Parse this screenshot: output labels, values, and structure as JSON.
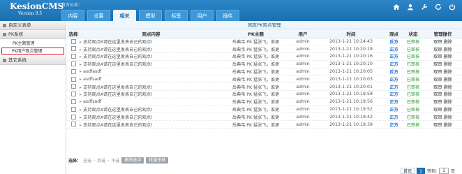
{
  "header": {
    "logo_name": "KesionCMS",
    "logo_version": "Version 9.5",
    "notice": "官方公告：",
    "tabs": [
      "内容",
      "设置",
      "相关",
      "模型",
      "标签",
      "用户",
      "插件"
    ],
    "active_tab": 2
  },
  "sidebar": {
    "groups": [
      {
        "label": "自定义表单",
        "items": []
      },
      {
        "label": "PK系统",
        "items": [
          "PK主题管理",
          "PK用户观点管理"
        ]
      },
      {
        "label": "其它系统",
        "items": []
      }
    ],
    "active_item": "PK用户观点管理"
  },
  "page_title": "网友PK观点管理",
  "table": {
    "headers": [
      "选择",
      "观点内容",
      "PK主题",
      "用户",
      "时间",
      "观点",
      "状态",
      "管理操作"
    ],
    "rows": [
      {
        "content": "支持观点B请在这里发表自己的观点!",
        "topic": "岳典韦 PK 猛张飞，谁更",
        "user": "admin",
        "time": "2013-1-21 10:24:43",
        "side": "反方",
        "status": "已审核",
        "op1": "取审",
        "op2": "删除"
      },
      {
        "content": "支持观点A请在这里发表自己的观点!",
        "topic": "岳典韦 PK 猛张飞，谁更",
        "user": "admin",
        "time": "2013-1-21 10:20:19",
        "side": "正方",
        "status": "已审核",
        "op1": "取审",
        "op2": "删除"
      },
      {
        "content": "支持观点A请在这里发表自己的观点!",
        "topic": "岳典韦 PK 猛张飞，谁更",
        "user": "admin",
        "time": "2013-1-21 10:20:16",
        "side": "正方",
        "status": "已审核",
        "op1": "取审",
        "op2": "删除"
      },
      {
        "content": "支持观点A请在这里发表自己的观点!",
        "topic": "岳典韦 PK 猛张飞，谁更",
        "user": "admin",
        "time": "2013-1-21 10:20:10",
        "side": "正方",
        "status": "已审核",
        "op1": "取审",
        "op2": "删除"
      },
      {
        "content": "asdfasdf",
        "topic": "岳典韦 PK 猛张飞，谁更",
        "user": "admin",
        "time": "2013-1-21 10:20:05",
        "side": "反方",
        "status": "已审核",
        "op1": "取审",
        "op2": "删除"
      },
      {
        "content": "asdfsadf",
        "topic": "岳典韦 PK 猛张飞，谁更",
        "user": "admin",
        "time": "2013-1-21 10:20:03",
        "side": "正方",
        "status": "已审核",
        "op1": "取审",
        "op2": "删除"
      },
      {
        "content": "支持观点A请在这里发表自己的观点!",
        "topic": "岳典韦 PK 猛张飞，谁更",
        "user": "admin",
        "time": "2013-1-21 10:20:01",
        "side": "正方",
        "status": "已审核",
        "op1": "取审",
        "op2": "删除"
      },
      {
        "content": "支持观点A请在这里发表自己的观点!",
        "topic": "岳典韦 PK 猛张飞，谁更",
        "user": "admin",
        "time": "2013-1-21 10:19:58",
        "side": "正方",
        "status": "已审核",
        "op1": "取审",
        "op2": "删除"
      },
      {
        "content": "asdfsadf",
        "topic": "岳典韦 PK 猛张飞，谁更",
        "user": "admin",
        "time": "2013-1-21 10:19:56",
        "side": "正方",
        "status": "已审核",
        "op1": "取审",
        "op2": "删除"
      },
      {
        "content": "支持观点A请在这里发表自己的观点!",
        "topic": "岳典韦 PK 猛张飞，谁更",
        "user": "admin",
        "time": "2013-1-21 10:19:52",
        "side": "正方",
        "status": "已审核",
        "op1": "取审",
        "op2": "删除"
      },
      {
        "content": "支持观点A请在这里发表自己的观点!",
        "topic": "岳典韦 PK 猛张飞，谁更",
        "user": "admin",
        "time": "2013-1-21 10:19:42",
        "side": "正方",
        "status": "已审核",
        "op1": "取审",
        "op2": "删除"
      },
      {
        "content": "支持观点A请在这里发表自己的观点!",
        "topic": "岳典韦 PK 猛张飞，谁更",
        "user": "admin",
        "time": "2013-1-21 10:19:39",
        "side": "正方",
        "status": "已审核",
        "op1": "取审",
        "op2": "删除"
      }
    ]
  },
  "footer": {
    "select_label": "选择：",
    "select_all": "全选",
    "select_invert": "反选",
    "select_none": "不选",
    "delete_btn": "删除选中",
    "approve_btn": "批量审核"
  },
  "pager": {
    "first": "首页",
    "current": "1",
    "goto_label": "转到:",
    "goto_value": "1",
    "page_unit": "页"
  },
  "colors": {
    "header": "#1b6fb0",
    "side": "#1a6fd6",
    "status": "#2a9a2a",
    "highlight": "#e0131f"
  }
}
